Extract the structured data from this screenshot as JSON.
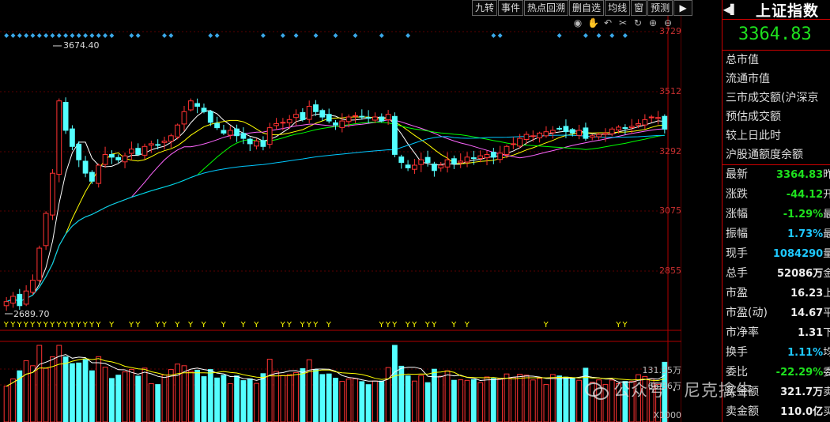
{
  "toolbar": {
    "buttons": [
      "九转",
      "事件",
      "热点回溯",
      "删自选",
      "均线",
      "窗",
      "预测"
    ],
    "arrow_icon": "play-right-icon"
  },
  "tools": [
    "eye-icon",
    "hand-icon",
    "undo-icon",
    "scissors-icon",
    "refresh-icon",
    "zoom-in-icon",
    "zoom-out-icon"
  ],
  "price_axis": [
    "3729",
    "3512",
    "3292",
    "3075",
    "2855"
  ],
  "volume_axis": {
    "top": "131.35万",
    "mid": "66.36万",
    "unit": "X1000"
  },
  "callouts": {
    "high": "3674.40",
    "low": "2689.70"
  },
  "panel": {
    "title": "上证指数",
    "price": "3364.83",
    "labels": [
      "总市值",
      "流通市值",
      "三市成交额(沪深京",
      "预估成交额",
      "较上日此时",
      "沪股通额度余额"
    ],
    "rows": [
      {
        "k": "最新",
        "v": "3364.83",
        "e": "昨",
        "color": "#1ee11e"
      },
      {
        "k": "涨跌",
        "v": "-44.12",
        "e": "开",
        "color": "#1ee11e"
      },
      {
        "k": "涨幅",
        "v": "-1.29%",
        "e": "最",
        "color": "#1ee11e"
      },
      {
        "k": "振幅",
        "v": "1.73%",
        "e": "最",
        "color": "#1ec8ff"
      },
      {
        "k": "现手",
        "v": "1084290",
        "e": "量",
        "color": "#1ec8ff"
      },
      {
        "k": "总手",
        "v": "52086万",
        "e": "金",
        "color": "#eeeeee"
      },
      {
        "k": "市盈",
        "v": "16.23",
        "e": "上",
        "color": "#eeeeee"
      },
      {
        "k": "市盈(动)",
        "v": "14.67",
        "e": "平",
        "color": "#eeeeee"
      },
      {
        "k": "市净率",
        "v": "1.31",
        "e": "下",
        "color": "#eeeeee"
      },
      {
        "k": "换手",
        "v": "1.11%",
        "e": "均",
        "color": "#1ec8ff"
      },
      {
        "k": "委比",
        "v": "-22.29%",
        "e": "委",
        "color": "#1ee11e"
      },
      {
        "k": "买金额",
        "v": "321.7万",
        "e": "卖",
        "color": "#eeeeee"
      },
      {
        "k": "卖金额",
        "v": "110.0亿",
        "e": "买",
        "color": "#eeeeee"
      }
    ]
  },
  "watermark": "公众号 · 尼克擒牛",
  "signals": "Y",
  "colors": {
    "up": "#ff3232",
    "down": "#54ffff",
    "ma5": "#ffffff",
    "ma10": "#ffff00",
    "ma20": "#ff66ff",
    "ma30": "#00ff00",
    "ma60": "#00c8ff"
  },
  "chart_data": {
    "type": "candlestick",
    "price_range": [
      2689.7,
      3729
    ],
    "marked_high": 3674.4,
    "marked_low": 2689.7,
    "closes": [
      2720,
      2740,
      2705,
      2760,
      2800,
      2920,
      3050,
      3200,
      3470,
      3360,
      3300,
      3250,
      3200,
      3170,
      3230,
      3270,
      3260,
      3250,
      3265,
      3290,
      3270,
      3300,
      3310,
      3305,
      3320,
      3340,
      3380,
      3430,
      3470,
      3450,
      3430,
      3390,
      3370,
      3350,
      3360,
      3340,
      3330,
      3310,
      3320,
      3300,
      3370,
      3385,
      3390,
      3400,
      3420,
      3400,
      3450,
      3430,
      3410,
      3395,
      3380,
      3395,
      3410,
      3415,
      3410,
      3405,
      3410,
      3395,
      3420,
      3270,
      3240,
      3220,
      3230,
      3250,
      3240,
      3210,
      3230,
      3250,
      3235,
      3245,
      3260,
      3255,
      3265,
      3270,
      3260,
      3275,
      3300,
      3310,
      3330,
      3345,
      3340,
      3350,
      3355,
      3360,
      3365,
      3355,
      3350,
      3360,
      3330,
      3340,
      3345,
      3350,
      3365,
      3372,
      3370,
      3375,
      3385,
      3400,
      3410,
      3408,
      3364.83
    ]
  }
}
